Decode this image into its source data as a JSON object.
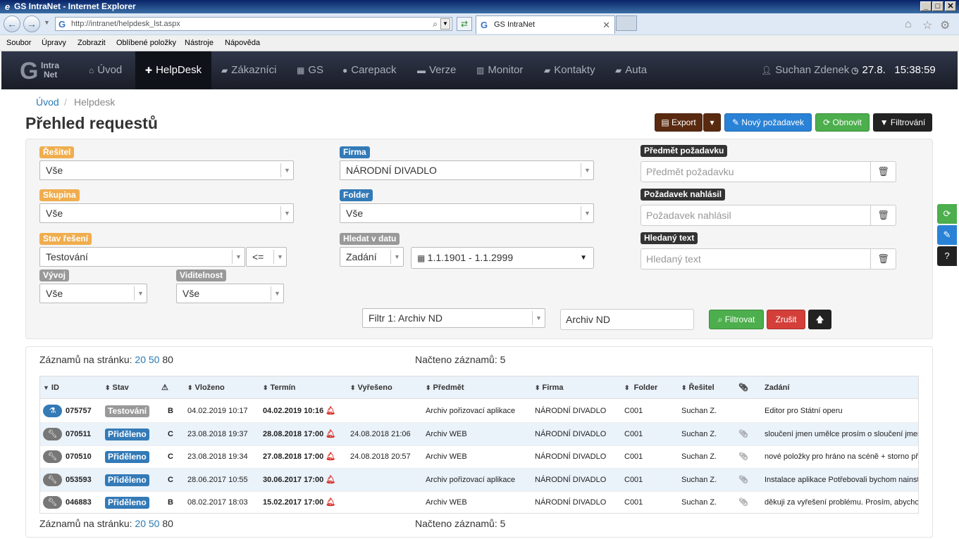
{
  "window": {
    "title": "GS IntraNet - Internet Explorer"
  },
  "browser": {
    "url": "http://intranet/helpdesk_lst.aspx",
    "tab_title": "GS IntraNet"
  },
  "menu": [
    "Soubor",
    "Úpravy",
    "Zobrazit",
    "Oblíbené položky",
    "Nástroje",
    "Nápověda"
  ],
  "logo": {
    "letter": "G",
    "line1": "Intra",
    "line2": "Net"
  },
  "nav": {
    "items": [
      "Úvod",
      "HelpDesk",
      "Zákazníci",
      "GS",
      "Carepack",
      "Verze",
      "Monitor",
      "Kontakty",
      "Auta"
    ],
    "user": "Suchan Zdenek",
    "date": "27.8.",
    "time": "15:38:59"
  },
  "breadcrumb": {
    "home": "Úvod",
    "sep": "/",
    "current": "Helpdesk"
  },
  "page": {
    "title": "Přehled requestů"
  },
  "toolbar": {
    "export": "Export",
    "new": "Nový požadavek",
    "refresh": "Obnovit",
    "filter": "Filtrování"
  },
  "filters": {
    "resitel": {
      "label": "Řešitel",
      "value": "Vše"
    },
    "skupina": {
      "label": "Skupina",
      "value": "Vše"
    },
    "stav": {
      "label": "Stav řešení",
      "value": "Testování",
      "op": "<="
    },
    "vyvoj": {
      "label": "Vývoj",
      "value": "Vše"
    },
    "viditelnost": {
      "label": "Viditelnost",
      "value": "Vše"
    },
    "firma": {
      "label": "Firma",
      "value": "NÁRODNÍ DIVADLO"
    },
    "folder": {
      "label": "Folder",
      "value": "Vše"
    },
    "datum": {
      "label": "Hledat v datu",
      "type": "Zadání",
      "range": "1.1.1901 - 1.1.2999"
    },
    "predmet": {
      "label": "Předmět požadavku",
      "placeholder": "Předmět požadavku"
    },
    "nahlasil": {
      "label": "Požadavek nahlásil",
      "placeholder": "Požadavek nahlásil"
    },
    "text": {
      "label": "Hledaný text",
      "placeholder": "Hledaný text"
    },
    "saved": {
      "value": "Filtr 1: Archiv ND",
      "name": "Archiv ND"
    },
    "apply": "Filtrovat",
    "cancel": "Zrušit"
  },
  "paging": {
    "label": "Záznamů na stránku:",
    "opt1": "20",
    "opt2": "50",
    "opt3": "80",
    "loaded_label": "Načteno záznamů:",
    "loaded": "5"
  },
  "table": {
    "headers": [
      "ID",
      "Stav",
      "Vloženo",
      "Termín",
      "Vyřešeno",
      "Předmět",
      "Firma",
      "Folder",
      "Řešitel",
      "Zadání"
    ],
    "rows": [
      {
        "id": "075757",
        "stav": "Testování",
        "pri": "B",
        "vlozeno": "04.02.2019 10:17",
        "termin": "04.02.2019 10:16",
        "vyreseno": "",
        "predmet": "Archiv pořizovací aplikace",
        "firma": "NÁRODNÍ DIVADLO",
        "folder": "C001",
        "resitel": "Suchan Z.",
        "zadani": "Editor pro Státní operu"
      },
      {
        "id": "070511",
        "stav": "Přiděleno",
        "pri": "C",
        "vlozeno": "23.08.2018 19:37",
        "termin": "28.08.2018 17:00",
        "vyreseno": "24.08.2018 21:06",
        "predmet": "Archiv WEB",
        "firma": "NÁRODNÍ DIVADLO",
        "folder": "C001",
        "resitel": "Suchan Z.",
        "zadani": "sloučení jmen umělce prosím o sloučení jmen"
      },
      {
        "id": "070510",
        "stav": "Přiděleno",
        "pri": "C",
        "vlozeno": "23.08.2018 19:34",
        "termin": "27.08.2018 17:00",
        "vyreseno": "24.08.2018 20:57",
        "predmet": "Archiv WEB",
        "firma": "NÁRODNÍ DIVADLO",
        "folder": "C001",
        "resitel": "Suchan Z.",
        "zadani": "nové položky pro hráno na scéně + storno při"
      },
      {
        "id": "053593",
        "stav": "Přiděleno",
        "pri": "C",
        "vlozeno": "28.06.2017 10:55",
        "termin": "30.06.2017 17:00",
        "vyreseno": "",
        "predmet": "Archiv pořizovací aplikace",
        "firma": "NÁRODNÍ DIVADLO",
        "folder": "C001",
        "resitel": "Suchan Z.",
        "zadani": "Instalace aplikace Potřebovali bychom nainst"
      },
      {
        "id": "046883",
        "stav": "Přiděleno",
        "pri": "B",
        "vlozeno": "08.02.2017 18:03",
        "termin": "15.02.2017 17:00",
        "vyreseno": "",
        "predmet": "Archiv WEB",
        "firma": "NÁRODNÍ DIVADLO",
        "folder": "C001",
        "resitel": "Suchan Z.",
        "zadani": "děkuji za vyřešení problému. Prosím, abycho"
      }
    ]
  }
}
